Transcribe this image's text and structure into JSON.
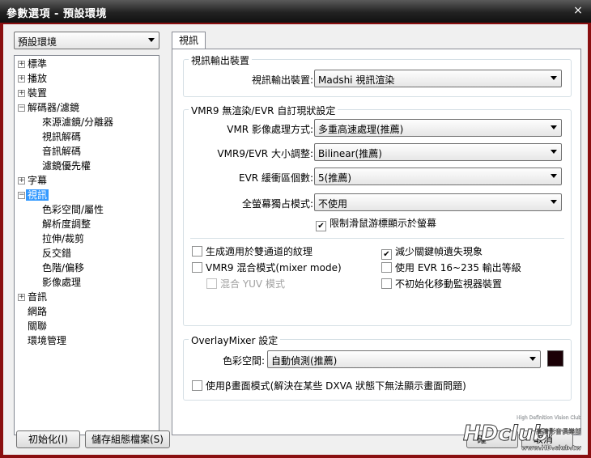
{
  "window": {
    "title": "參數選項 - 預設環境",
    "close_glyph": "×"
  },
  "profile": {
    "selected": "預設環境"
  },
  "tree": [
    {
      "label": "標準",
      "expander": "+"
    },
    {
      "label": "播放",
      "expander": "+"
    },
    {
      "label": "裝置",
      "expander": "+"
    },
    {
      "label": "解碼器/濾鏡",
      "expander": "−"
    },
    {
      "label": "來源濾鏡/分離器"
    },
    {
      "label": "視訊解碼"
    },
    {
      "label": "音訊解碼"
    },
    {
      "label": "濾鏡優先權"
    },
    {
      "label": "字幕",
      "expander": "+"
    },
    {
      "label": "視訊",
      "expander": "−"
    },
    {
      "label": "色彩空間/屬性"
    },
    {
      "label": "解析度調整"
    },
    {
      "label": "拉伸/裁剪"
    },
    {
      "label": "反交錯"
    },
    {
      "label": "色階/偏移"
    },
    {
      "label": "影像處理"
    },
    {
      "label": "音訊",
      "expander": "+"
    },
    {
      "label": "網路"
    },
    {
      "label": "關聯"
    },
    {
      "label": "環境管理"
    }
  ],
  "tab": {
    "label": "視訊"
  },
  "output_group": {
    "title": "視訊輸出裝置",
    "device_label": "視訊輸出裝置:",
    "device_value": "Madshi 視訊渲染"
  },
  "vmr_group": {
    "title": "VMR9 無渲染/EVR 自訂現狀設定",
    "rows": [
      {
        "label": "VMR 影像處理方式:",
        "value": "多重高速處理(推薦)"
      },
      {
        "label": "VMR9/EVR 大小調整:",
        "value": "Bilinear(推薦)"
      },
      {
        "label": "EVR 緩衝區個數:",
        "value": "5(推薦)"
      },
      {
        "label": "全螢幕獨占模式:",
        "value": "不使用"
      }
    ],
    "limit_cursor": "限制滑鼠游標顯示於螢幕",
    "left_checks": [
      "生成適用於雙通道的紋理",
      "VMR9 混合模式(mixer mode)",
      "混合 YUV 模式"
    ],
    "right_checks": [
      "減少關鍵幀遺失現象",
      "使用 EVR 16~235 輸出等級",
      "不初始化移動監視器裝置"
    ]
  },
  "overlay_group": {
    "title": "OverlayMixer 設定",
    "colorspace_label": "色彩空間:",
    "colorspace_value": "自動偵測(推薦)",
    "beta_mode": "使用β畫面模式(解決在某些 DXVA 狀態下無法顯示畫面問題)"
  },
  "buttons": {
    "init": "初始化(I)",
    "save": "儲存組態檔案(S)",
    "ok_partial": "確",
    "cancel_partial": "取消"
  },
  "watermark": {
    "line1": "High Definition Vision Club",
    "logo": "HDclub",
    "url": "www.HD.club.tw",
    "cn": "高清影音俱樂部"
  }
}
